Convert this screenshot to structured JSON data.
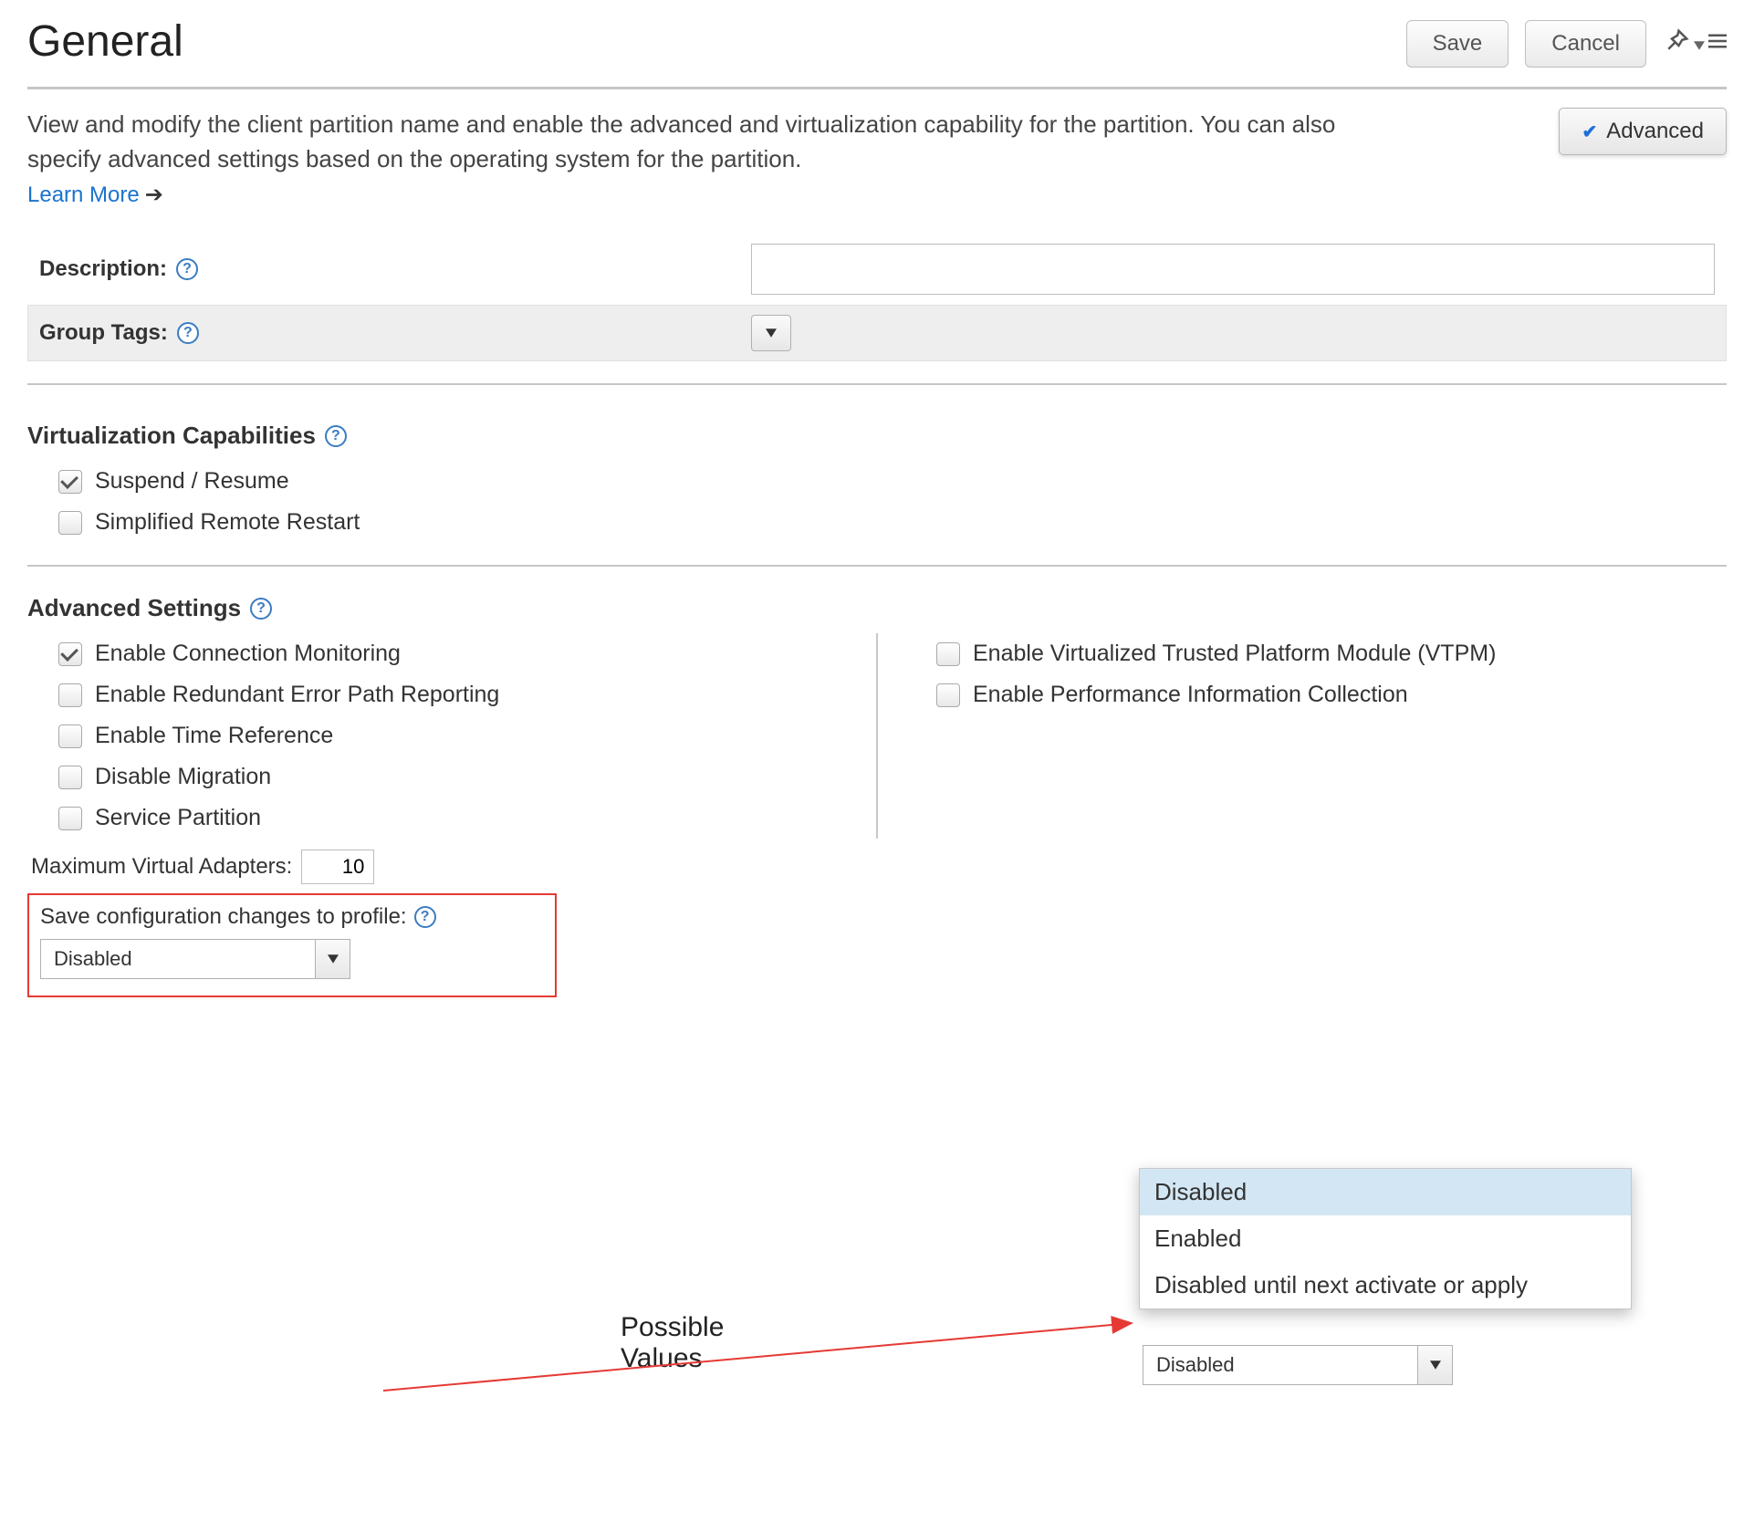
{
  "header": {
    "title": "General",
    "save_label": "Save",
    "cancel_label": "Cancel",
    "advanced_label": "Advanced"
  },
  "intro": {
    "text": "View and modify the client partition name and enable the advanced and virtualization capability for the partition. You can also specify advanced settings based on the operating system for the partition.",
    "learn_more": "Learn More"
  },
  "form": {
    "description_label": "Description:",
    "description_value": "",
    "group_tags_label": "Group Tags:"
  },
  "virtualization": {
    "title": "Virtualization Capabilities",
    "items": [
      {
        "label": "Suspend / Resume",
        "checked": true
      },
      {
        "label": "Simplified Remote Restart",
        "checked": false
      }
    ]
  },
  "advanced": {
    "title": "Advanced Settings",
    "left": [
      {
        "label": "Enable Connection Monitoring",
        "checked": true
      },
      {
        "label": "Enable Redundant Error Path Reporting",
        "checked": false
      },
      {
        "label": "Enable Time Reference",
        "checked": false
      },
      {
        "label": "Disable Migration",
        "checked": false
      },
      {
        "label": "Service Partition",
        "checked": false
      }
    ],
    "right": [
      {
        "label": "Enable Virtualized Trusted Platform Module (VTPM)",
        "checked": false
      },
      {
        "label": "Enable Performance Information Collection",
        "checked": false
      }
    ],
    "max_adapters_label": "Maximum Virtual Adapters:",
    "max_adapters_value": "10",
    "save_config_label": "Save configuration changes to profile:",
    "save_config_selected": "Disabled",
    "save_config_options": [
      "Disabled",
      "Enabled",
      "Disabled until next activate or apply"
    ]
  },
  "annotation": {
    "possible_values": "Possible\nValues"
  },
  "dup_select_value": "Disabled"
}
